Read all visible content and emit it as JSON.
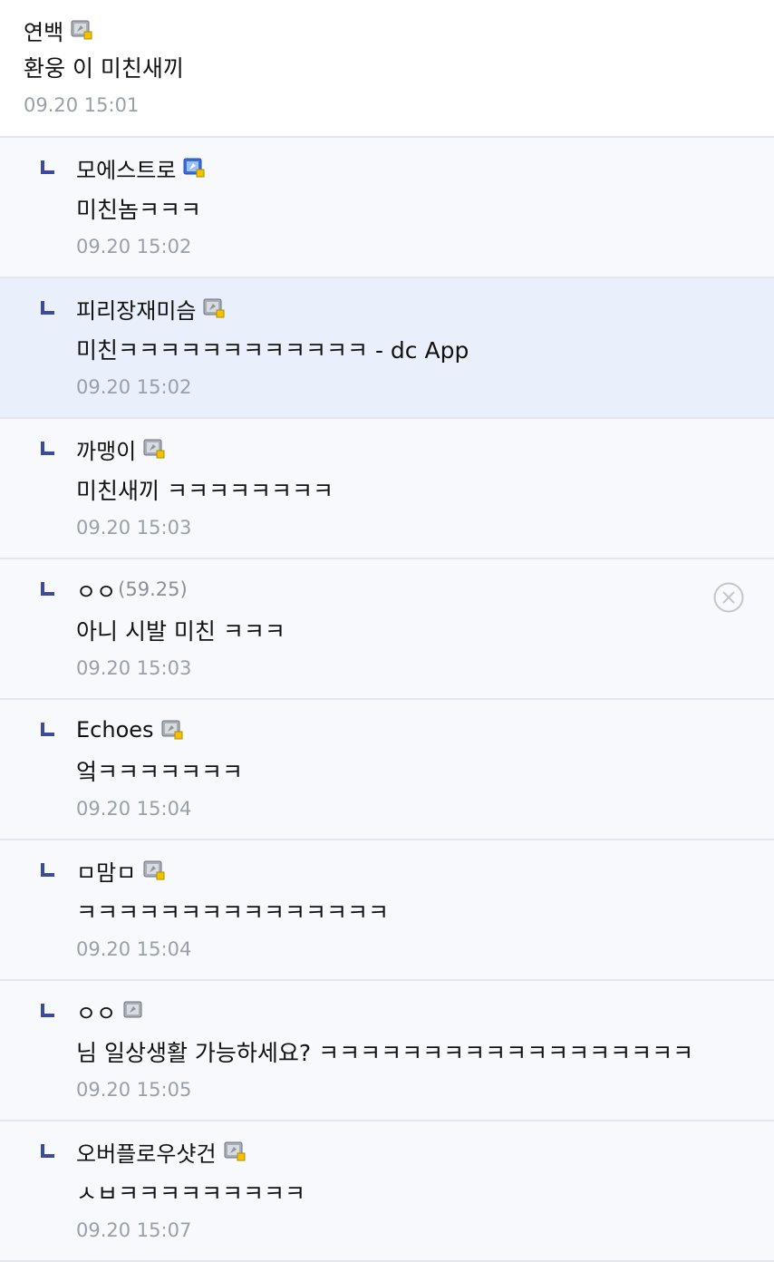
{
  "parent": {
    "nickname": "연백",
    "text": "환웅 이 미친새끼",
    "time": "09.20 15:01",
    "badge_icon": "gallery-member-badge-icon"
  },
  "replies": [
    {
      "nickname": "모에스트로",
      "text": "미친놈ㅋㅋㅋ",
      "time": "09.20 15:02",
      "badge": "fixed-nick-blue"
    },
    {
      "nickname": "피리장재미슴",
      "text": "미친ㅋㅋㅋㅋㅋㅋㅋㅋㅋㅋㅋㅋ - dc App",
      "time": "09.20 15:02",
      "badge": "fixed-nick-gray",
      "highlight": true
    },
    {
      "nickname": "까맹이",
      "text": "미친새끼 ㅋㅋㅋㅋㅋㅋㅋㅋ",
      "time": "09.20 15:03",
      "badge": "fixed-nick-gray"
    },
    {
      "nickname": "ㅇㅇ",
      "ip": "(59.25)",
      "text": "아니 시발 미친 ㅋㅋㅋ",
      "time": "09.20 15:03",
      "badge": "none",
      "deletable": true
    },
    {
      "nickname": "Echoes",
      "text": "엌ㅋㅋㅋㅋㅋㅋㅋ",
      "time": "09.20 15:04",
      "badge": "fixed-nick-gray"
    },
    {
      "nickname": "ㅁ맘ㅁ",
      "text": "ㅋㅋㅋㅋㅋㅋㅋㅋㅋㅋㅋㅋㅋㅋㅋ",
      "time": "09.20 15:04",
      "badge": "fixed-nick-gray"
    },
    {
      "nickname": "ㅇㅇ",
      "text": "님 일상생활 가능하세요? ㅋㅋㅋㅋㅋㅋㅋㅋㅋㅋㅋㅋㅋㅋㅋㅋㅋㅋ",
      "time": "09.20 15:05",
      "badge": "half-nick-gray"
    },
    {
      "nickname": "오버플로우샷건",
      "text": "ㅅㅂㅋㅋㅋㅋㅋㅋㅋㅋㅋ",
      "time": "09.20 15:07",
      "badge": "fixed-nick-gray"
    }
  ],
  "icons": {
    "reply_marker": "reply-corner-icon",
    "delete": "close-circle-icon"
  },
  "colors": {
    "reply_marker": "#3b4a9c",
    "badge_blue": "#3a6fd8",
    "badge_gray": "#8e939c",
    "badge_corner": "#f2c200",
    "timestamp": "#9aa0aa",
    "highlight_bg": "#eaf0fb"
  }
}
